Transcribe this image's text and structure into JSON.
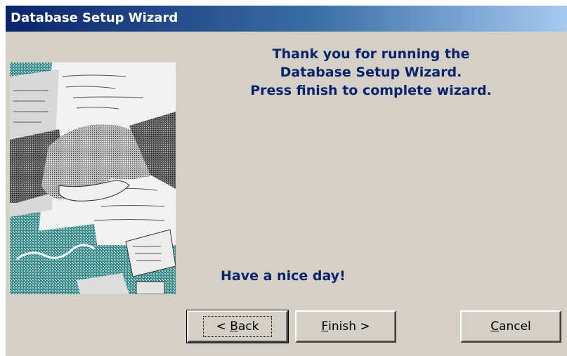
{
  "window": {
    "title": "Database Setup Wizard"
  },
  "content": {
    "message_lines": [
      "Thank you for running the",
      "Database Setup Wizard.",
      "Press finish to complete wizard."
    ],
    "goodbye": "Have a nice day!",
    "picture": "handshake-illustration"
  },
  "buttons": {
    "back": {
      "prefix": "< ",
      "accel": "B",
      "rest": "ack"
    },
    "finish": {
      "accel": "F",
      "rest": "inish >"
    },
    "cancel": {
      "accel": "C",
      "rest": "ancel"
    }
  },
  "colors": {
    "title_gradient_start": "#0a246a",
    "title_gradient_end": "#a6caf0",
    "dialog_background": "#d4d0c8",
    "message_text": "#0a246a"
  }
}
